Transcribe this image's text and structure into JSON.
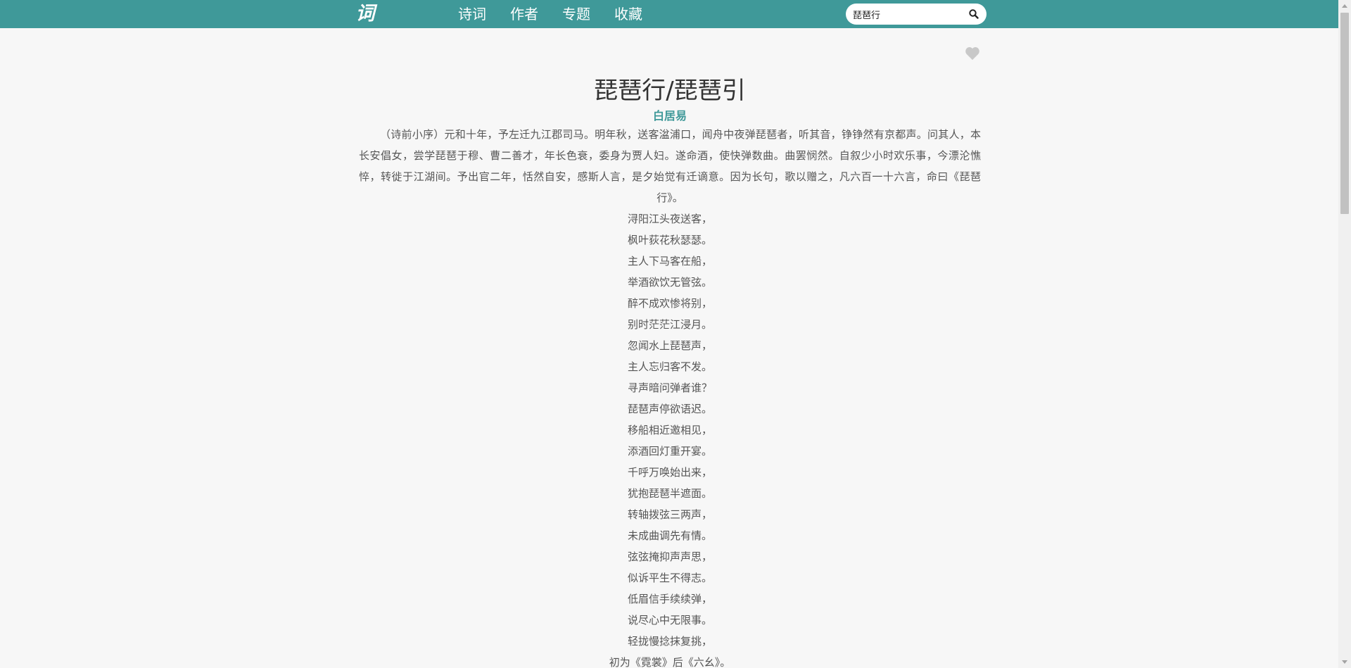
{
  "header": {
    "logo_text": "词",
    "nav": [
      {
        "label": "诗词"
      },
      {
        "label": "作者"
      },
      {
        "label": "专题"
      },
      {
        "label": "收藏"
      }
    ],
    "search": {
      "value": "琵琶行",
      "placeholder": "",
      "icon": "search-icon"
    }
  },
  "poem": {
    "favorite_icon": "heart-icon",
    "title": "琵琶行/琵琶引",
    "author": "白居易",
    "preface": "（诗前小序）元和十年，予左迁九江郡司马。明年秋，送客湓浦口，闻舟中夜弹琵琶者，听其音，铮铮然有京都声。问其人，本长安倡女，尝学琵琶于穆、曹二善才，年长色衰，委身为贾人妇。遂命酒，使快弹数曲。曲罢悯然。自叙少小时欢乐事，今漂沦憔悴，转徙于江湖间。予出官二年，恬然自安，感斯人言，是夕始觉有迁谪意。因为长句，歌以赠之，凡六百一十六言，命曰《琵琶行》。",
    "lines": [
      "浔阳江头夜送客，",
      "枫叶荻花秋瑟瑟。",
      "主人下马客在船，",
      "举酒欲饮无管弦。",
      "醉不成欢惨将别，",
      "别时茫茫江浸月。",
      "忽闻水上琵琶声，",
      "主人忘归客不发。",
      "寻声暗问弹者谁？",
      "琵琶声停欲语迟。",
      "移船相近邀相见，",
      "添酒回灯重开宴。",
      "千呼万唤始出来，",
      "犹抱琵琶半遮面。",
      "转轴拨弦三两声，",
      "未成曲调先有情。",
      "弦弦掩抑声声思，",
      "似诉平生不得志。",
      "低眉信手续续弹，",
      "说尽心中无限事。",
      "轻拢慢捻抹复挑，",
      "初为《霓裳》后《六幺》。"
    ]
  },
  "colors": {
    "header_bg": "#3f9999",
    "accent": "#3f9999",
    "page_bg": "#f7f7f7",
    "text": "#555555"
  }
}
